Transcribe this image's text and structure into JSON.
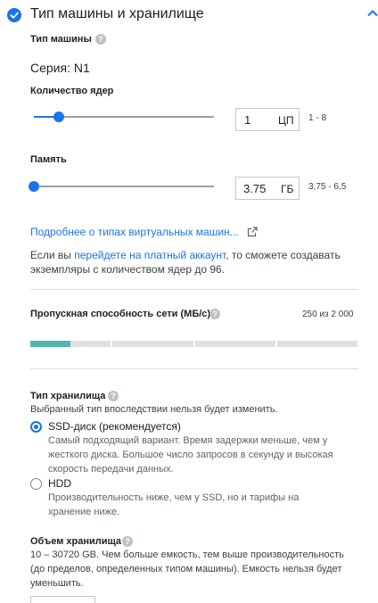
{
  "header": {
    "title": "Тип машины и хранилище"
  },
  "machine_type": {
    "label": "Тип машины",
    "series": "Серия: N1",
    "cores": {
      "label": "Количество ядер",
      "value": "1",
      "unit": "ЦП",
      "range": "1 - 8",
      "slider_fraction": 0.14
    },
    "memory": {
      "label": "Память",
      "value": "3.75",
      "unit": "ГБ",
      "range": "3,75 - 6,5",
      "slider_fraction": 0.0
    },
    "learn_more_link": "Подробнее о типах виртуальных машин...",
    "info": {
      "prefix": "Если вы ",
      "link": "перейдете на платный аккаунт",
      "suffix": ", то сможете создавать экземпляры с количеством ядер до 96."
    }
  },
  "network": {
    "label": "Пропускная способность сети (МБ/с)",
    "value_text": "250 из 2 000",
    "value": 250,
    "max": 2000
  },
  "storage_type": {
    "label": "Тип хранилища",
    "description": "Выбранный тип впоследствии нельзя будет изменить.",
    "options": [
      {
        "title": "SSD-диск (рекомендуется)",
        "description": "Самый подходящий вариант. Время задержки меньше, чем у жесткого диска. Большое число запросов в секунду и высокая скорость передачи данных.",
        "selected": true
      },
      {
        "title": "HDD",
        "description": "Производительность ниже, чем у SSD, но и тарифы на хранение ниже.",
        "selected": false
      }
    ]
  },
  "storage_size": {
    "label": "Объем хранилища",
    "description": "10 – 30720 GB. Чем больше емкость, тем выше производительность (до пределов, определенных типом машины). Емкость нельзя будет уменьшить."
  },
  "colors": {
    "accent": "#1a73e8",
    "network_fill": "#4db6ac"
  }
}
